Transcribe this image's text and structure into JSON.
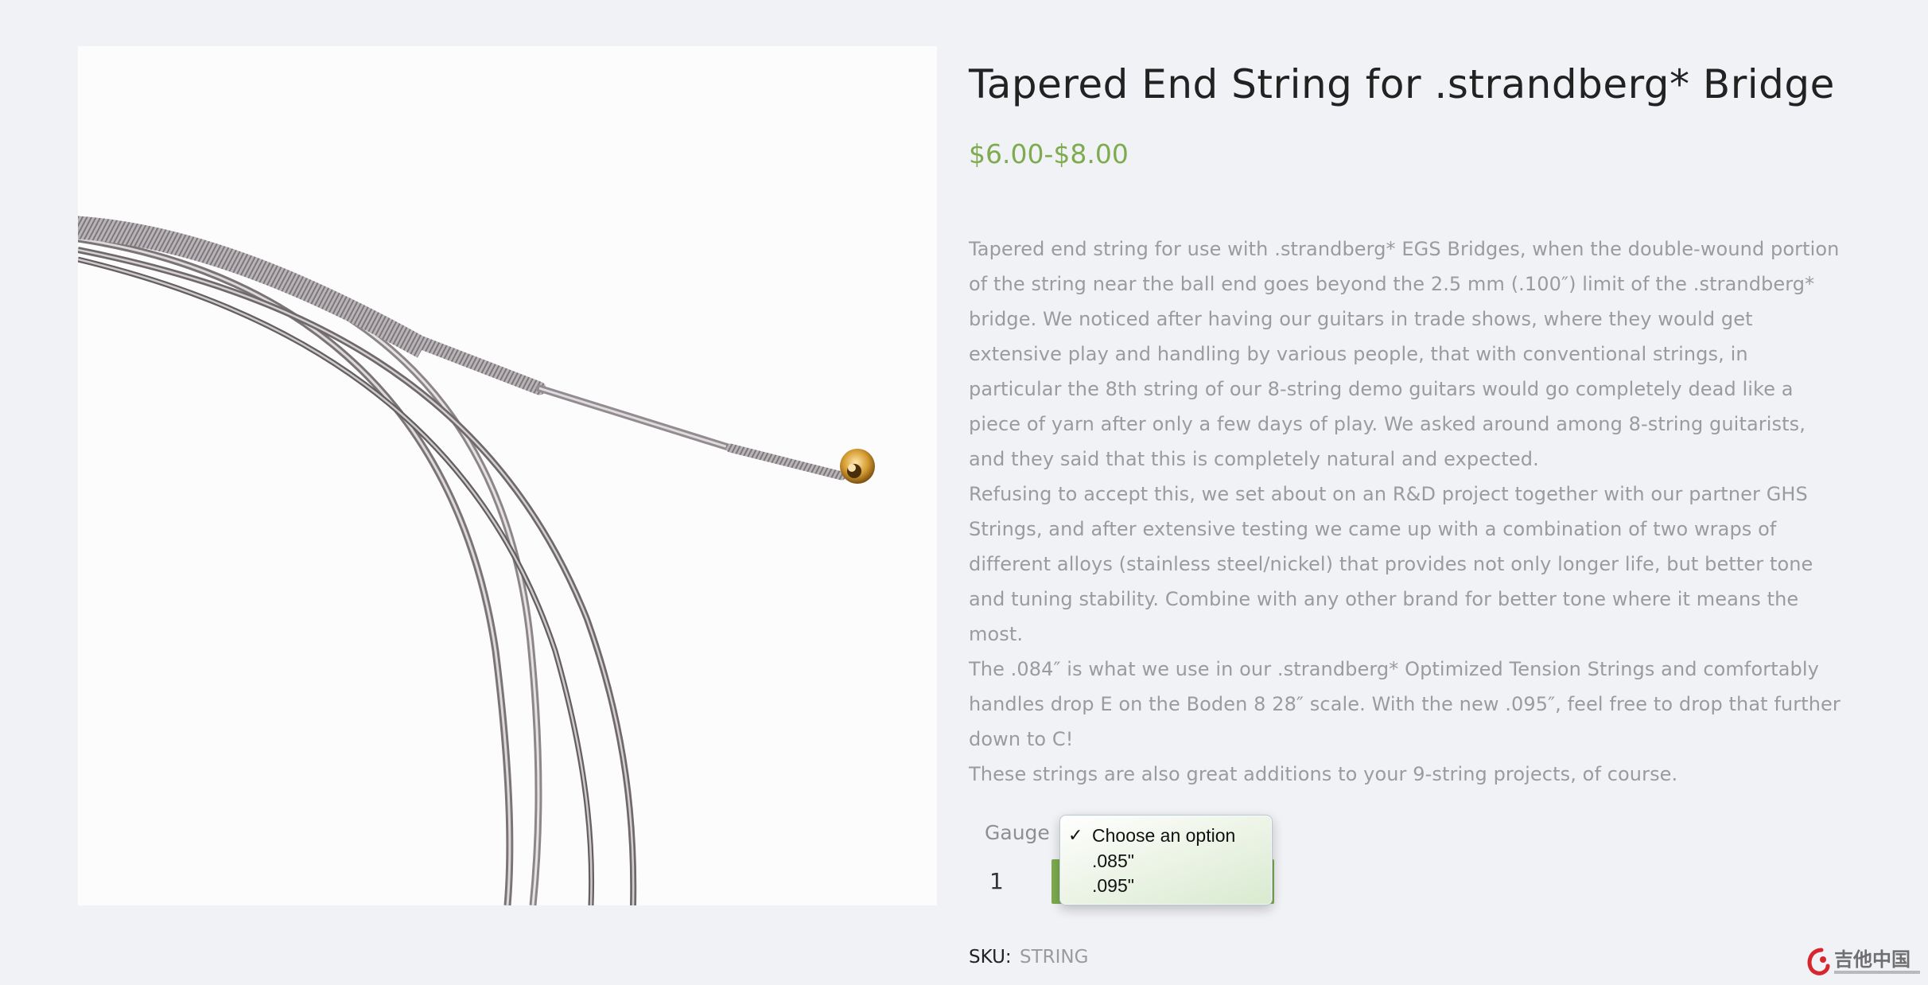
{
  "product": {
    "title": "Tapered End String for .strandberg* Bridge",
    "price": "$6.00-$8.00",
    "description": [
      "Tapered end string for use with .strandberg* EGS Bridges, when the double-wound portion of the string near the ball end goes beyond the 2.5 mm (.100″) limit of the .strandberg* bridge. We noticed after having our guitars in trade shows, where they would get extensive play and handling by various people, that with conventional strings, in particular the 8th string of our 8-string demo guitars would go completely dead like a piece of yarn after only a few days of play. We asked around among 8-string guitarists, and they said that this is completely natural and expected.",
      "Refusing to accept this, we set about on an R&D project together with our partner GHS Strings, and after extensive testing we came up with a combination of two wraps of different alloys (stainless steel/nickel) that provides not only longer life, but better tone and tuning stability. Combine with any other brand for better tone where it means the most.",
      "The .084″ is what we use in our .strandberg* Optimized Tension Strings and comfortably handles drop E on the Boden 8 28″ scale. With the new .095″, feel free to drop that further down to C!",
      "These strings are also great additions to your 9-string projects, of course."
    ]
  },
  "variation": {
    "gauge_label": "Gauge",
    "dropdown": {
      "selected": "Choose an option",
      "options": [
        "Choose an option",
        ".085\"",
        ".095\""
      ],
      "checkmark": "✓"
    }
  },
  "cart": {
    "quantity": "1"
  },
  "meta": {
    "sku_label": "SKU:",
    "sku_value": "STRING"
  },
  "watermark": {
    "text": "吉他中国"
  },
  "colors": {
    "accent": "#7eab4f",
    "background": "#f1f2f5",
    "body_text": "#9b9b9e",
    "title": "#222222"
  },
  "icons": {
    "checkmark": "checkmark-icon",
    "watermark_logo": "guitar-china-logo-icon"
  }
}
